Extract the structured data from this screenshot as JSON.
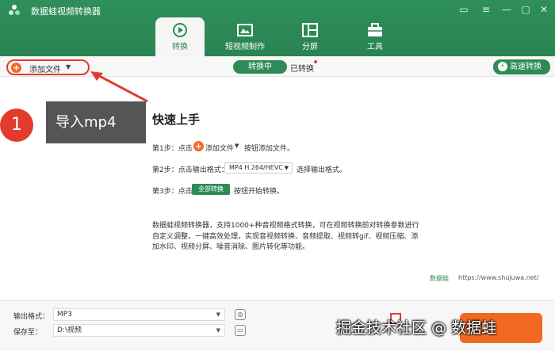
{
  "app": {
    "title": "数据蛙视频转换器",
    "accent": "#2e8b57"
  },
  "window_controls": [
    "chat-icon",
    "menu-icon",
    "minimize-icon",
    "maximize-icon",
    "close-icon"
  ],
  "main_tabs": [
    {
      "label": "转换",
      "icon": "convert-icon",
      "active": true
    },
    {
      "label": "短视频制作",
      "icon": "short-video-icon",
      "active": false
    },
    {
      "label": "分屏",
      "icon": "split-screen-icon",
      "active": false
    },
    {
      "label": "工具",
      "icon": "toolbox-icon",
      "active": false
    }
  ],
  "subbar": {
    "add_file": "添加文件",
    "tab_converting": "转换中",
    "tab_converted": "已转换",
    "fast_convert": "高速转换"
  },
  "callout": {
    "number": "1",
    "text": "导入mp4",
    "color": "#e23b2e"
  },
  "guide": {
    "title": "快速上手",
    "step1_prefix": "第1步：点击",
    "step1_button": "添加文件",
    "step1_suffix": "按钮添加文件。",
    "step2_prefix": "第2步：点击输出格式：",
    "step2_format": "MP4 H.264/HEVC",
    "step2_suffix": "选择输出格式。",
    "step3_prefix": "第3步：点击",
    "step3_button": "全部转换",
    "step3_suffix": "按钮开始转换。",
    "description": "数据蛙视频转换器，支持1000+种音视频格式转换，可在视频转换前对转换参数进行自定义调整，一键高效处理，实现音视频转换、音频提取、视频转gif、视频压缩、添加水印、视频分屏、噪音消除、图片转化等功能。"
  },
  "site": {
    "brand": "数据蛙",
    "url": "https://www.shujuwa.net/"
  },
  "bottom": {
    "output_format_label": "输出格式：",
    "output_format_value": "MP3",
    "save_to_label": "保存至：",
    "save_to_value": "D:\\视频"
  },
  "watermark": "掘金技术社区 @ 数据蛙"
}
